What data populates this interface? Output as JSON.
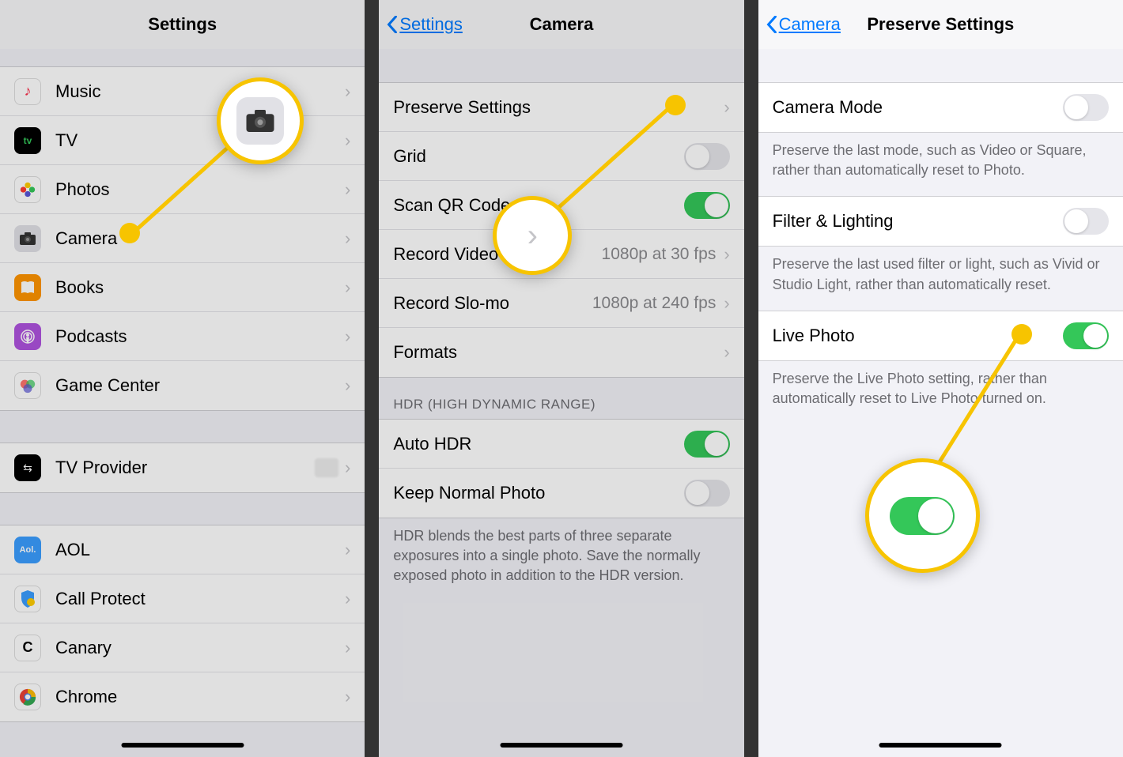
{
  "screen1": {
    "title": "Settings",
    "items": [
      "Music",
      "TV",
      "Photos",
      "Camera",
      "Books",
      "Podcasts",
      "Game Center"
    ],
    "items2": [
      "TV Provider"
    ],
    "items3": [
      "AOL",
      "Call Protect",
      "Canary",
      "Chrome"
    ]
  },
  "screen2": {
    "back": "Settings",
    "title": "Camera",
    "rows": {
      "preserve": "Preserve Settings",
      "grid": "Grid",
      "scanqr": "Scan QR Codes",
      "recvid": "Record Video",
      "recvid_val": "1080p at 30 fps",
      "recslo": "Record Slo-mo",
      "recslo_val": "1080p at 240 fps",
      "formats": "Formats"
    },
    "hdr_header": "HDR (HIGH DYNAMIC RANGE)",
    "autohdr": "Auto HDR",
    "keepnorm": "Keep Normal Photo",
    "hdr_footer": "HDR blends the best parts of three separate exposures into a single photo. Save the normally exposed photo in addition to the HDR version."
  },
  "screen3": {
    "back": "Camera",
    "title": "Preserve Settings",
    "cammode": "Camera Mode",
    "cammode_desc": "Preserve the last mode, such as Video or Square, rather than automatically reset to Photo.",
    "filter": "Filter & Lighting",
    "filter_desc": "Preserve the last used filter or light, such as Vivid or Studio Light, rather than automatically reset.",
    "live": "Live Photo",
    "live_desc": "Preserve the Live Photo setting, rather than automatically reset to Live Photo turned on."
  }
}
